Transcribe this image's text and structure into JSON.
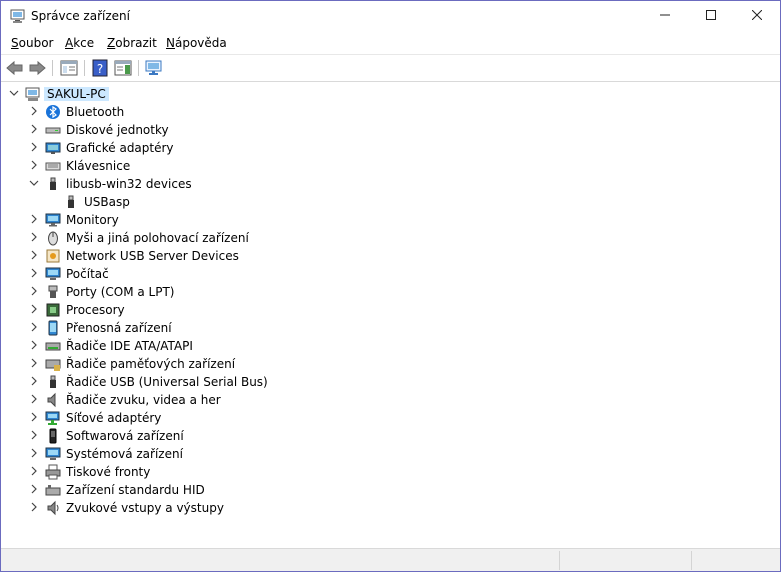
{
  "window": {
    "title": "Správce zařízení"
  },
  "menu": [
    {
      "pre": "",
      "u": "S",
      "post": "oubor"
    },
    {
      "pre": "",
      "u": "A",
      "post": "kce"
    },
    {
      "pre": "",
      "u": "Z",
      "post": "obrazit"
    },
    {
      "pre": "",
      "u": "N",
      "post": "ápověda"
    }
  ],
  "tree": {
    "root": "SAKUL-PC",
    "categories": [
      {
        "label": "Bluetooth",
        "icon": "bluetooth-icon"
      },
      {
        "label": "Diskové jednotky",
        "icon": "disk-drive-icon"
      },
      {
        "label": "Grafické adaptéry",
        "icon": "display-adapter-icon"
      },
      {
        "label": "Klávesnice",
        "icon": "keyboard-icon"
      },
      {
        "label": "libusb-win32 devices",
        "icon": "usb-plug-icon",
        "expanded": true,
        "children": [
          "USBasp"
        ]
      },
      {
        "label": "Monitory",
        "icon": "monitor-icon"
      },
      {
        "label": "Myši a jiná polohovací zařízení",
        "icon": "mouse-icon"
      },
      {
        "label": "Network USB Server Devices",
        "icon": "network-usb-server-icon"
      },
      {
        "label": "Počítač",
        "icon": "computer-icon"
      },
      {
        "label": "Porty (COM a LPT)",
        "icon": "port-icon"
      },
      {
        "label": "Procesory",
        "icon": "processor-icon"
      },
      {
        "label": "Přenosná zařízení",
        "icon": "portable-device-icon"
      },
      {
        "label": "Řadiče IDE ATA/ATAPI",
        "icon": "ide-controller-icon"
      },
      {
        "label": "Řadiče paměťových zařízení",
        "icon": "storage-controller-icon"
      },
      {
        "label": "Řadiče USB (Universal Serial Bus)",
        "icon": "usb-controller-icon"
      },
      {
        "label": "Řadiče zvuku, videa a her",
        "icon": "sound-icon"
      },
      {
        "label": "Síťové adaptéry",
        "icon": "network-adapter-icon"
      },
      {
        "label": "Softwarová zařízení",
        "icon": "software-device-icon"
      },
      {
        "label": "Systémová zařízení",
        "icon": "system-device-icon"
      },
      {
        "label": "Tiskové fronty",
        "icon": "printer-icon"
      },
      {
        "label": "Zařízení standardu HID",
        "icon": "hid-icon"
      },
      {
        "label": "Zvukové vstupy a výstupy",
        "icon": "audio-io-icon"
      }
    ]
  }
}
